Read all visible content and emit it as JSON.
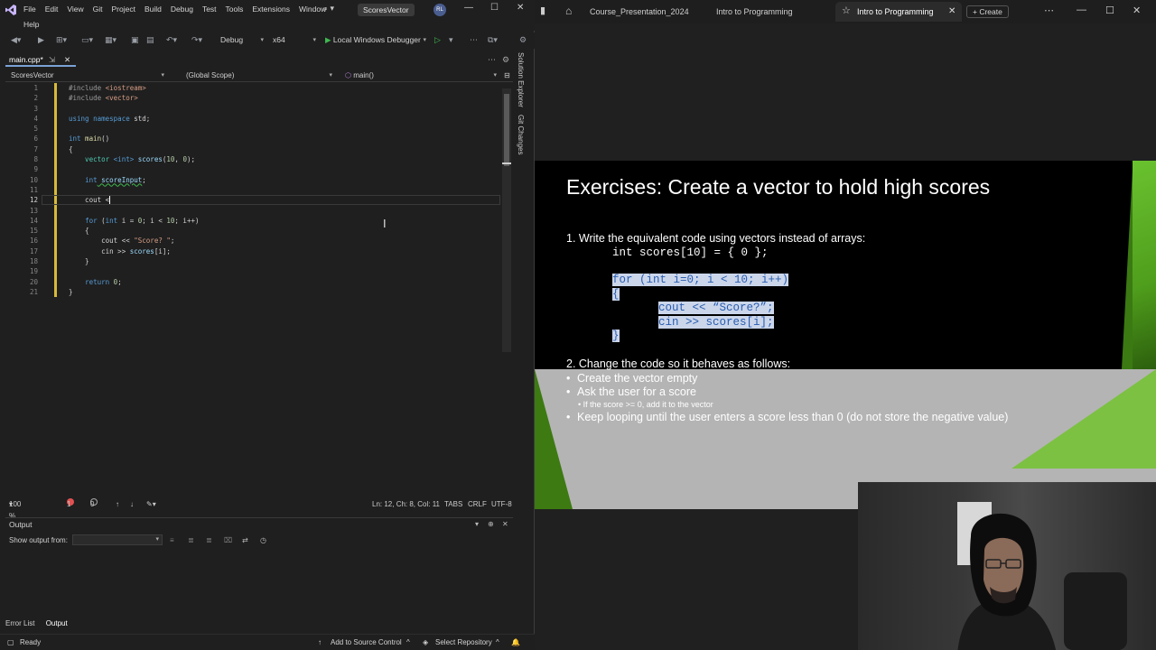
{
  "vs": {
    "menu": [
      "File",
      "Edit",
      "View",
      "Git",
      "Project",
      "Build",
      "Debug",
      "Test",
      "Tools",
      "Extensions",
      "Window"
    ],
    "menu_help": "Help",
    "solution_name": "ScoresVector",
    "avatar_initials": "RL",
    "toolbar": {
      "config": "Debug",
      "platform": "x64",
      "run_label": "Local Windows Debugger"
    },
    "tab": {
      "name": "main.cpp*"
    },
    "nav": {
      "project": "ScoresVector",
      "scope": "(Global Scope)",
      "member": "main()"
    },
    "line_numbers": [
      "1",
      "2",
      "3",
      "4",
      "5",
      "6",
      "7",
      "8",
      "9",
      "10",
      "11",
      "12",
      "13",
      "14",
      "15",
      "16",
      "17",
      "18",
      "19",
      "20",
      "21"
    ],
    "code": {
      "l1_a": "#include ",
      "l1_b": "<iostream>",
      "l2_a": "#include ",
      "l2_b": "<vector>",
      "l4_a": "using",
      "l4_b": " namespace",
      "l4_c": " std;",
      "l6_a": "int",
      "l6_b": " main",
      "l6_c": "()",
      "l7": "{",
      "l8_a": "    vector ",
      "l8_b": "<int>",
      "l8_c": " scores",
      "l8_d": "(",
      "l8_e": "10",
      "l8_f": ", ",
      "l8_g": "0",
      "l8_h": ");",
      "l10_a": "    ",
      "l10_b": "int",
      "l10_c": " scoreInput",
      "l10_d": ";",
      "l12_a": "    cout <",
      "l14_a": "    ",
      "l14_b": "for",
      "l14_c": " (",
      "l14_d": "int",
      "l14_e": " i = ",
      "l14_f": "0",
      "l14_g": "; i < ",
      "l14_h": "10",
      "l14_i": "; i++)",
      "l15": "    {",
      "l16_a": "        cout << ",
      "l16_b": "\"Score? \"",
      "l16_c": ";",
      "l17_a": "        cin >> ",
      "l17_b": "scores",
      "l17_c": "[i];",
      "l18": "    }",
      "l20_a": "    ",
      "l20_b": "return",
      "l20_c": " ",
      "l20_d": "0",
      "l20_e": ";",
      "l21": "}"
    },
    "status": {
      "zoom": "100 %",
      "errors": "1",
      "warnings": "0",
      "position": "Ln: 12, Ch: 8, Col: 11",
      "tabs": "TABS",
      "eol": "CRLF",
      "encoding": "UTF-8"
    },
    "output": {
      "title": "Output",
      "show_from": "Show output from:"
    },
    "bottom_tabs": [
      "Error List",
      "Output"
    ],
    "statusbar": {
      "ready": "Ready",
      "add_source": "Add to Source Control",
      "select_repo": "Select Repository"
    },
    "side_tools": [
      "Solution Explorer",
      "Git Changes"
    ]
  },
  "browser": {
    "tabs": [
      "Course_Presentation_2024",
      "Intro to Programming",
      "Intro to Programming"
    ],
    "create": "Create"
  },
  "slide": {
    "title": "Exercises: Create a vector to hold high scores",
    "item1": "1. Write the equivalent code using vectors instead of arrays:",
    "code1": "int scores[10] = { 0 };",
    "code2": "for (int i=0; i < 10; i++)",
    "code3": "{",
    "code4": "cout << “Score?”;",
    "code5": "cin >> scores[i];",
    "code6": "}",
    "item2": "2. Change the code so it behaves as follows:",
    "bullets": [
      "Create the vector empty",
      "Ask the user for a score",
      "Keep looping until the user enters a score less than 0 (do not store the negative value)"
    ],
    "sub_bullet": "If the score >= 0, add it to the vector"
  }
}
